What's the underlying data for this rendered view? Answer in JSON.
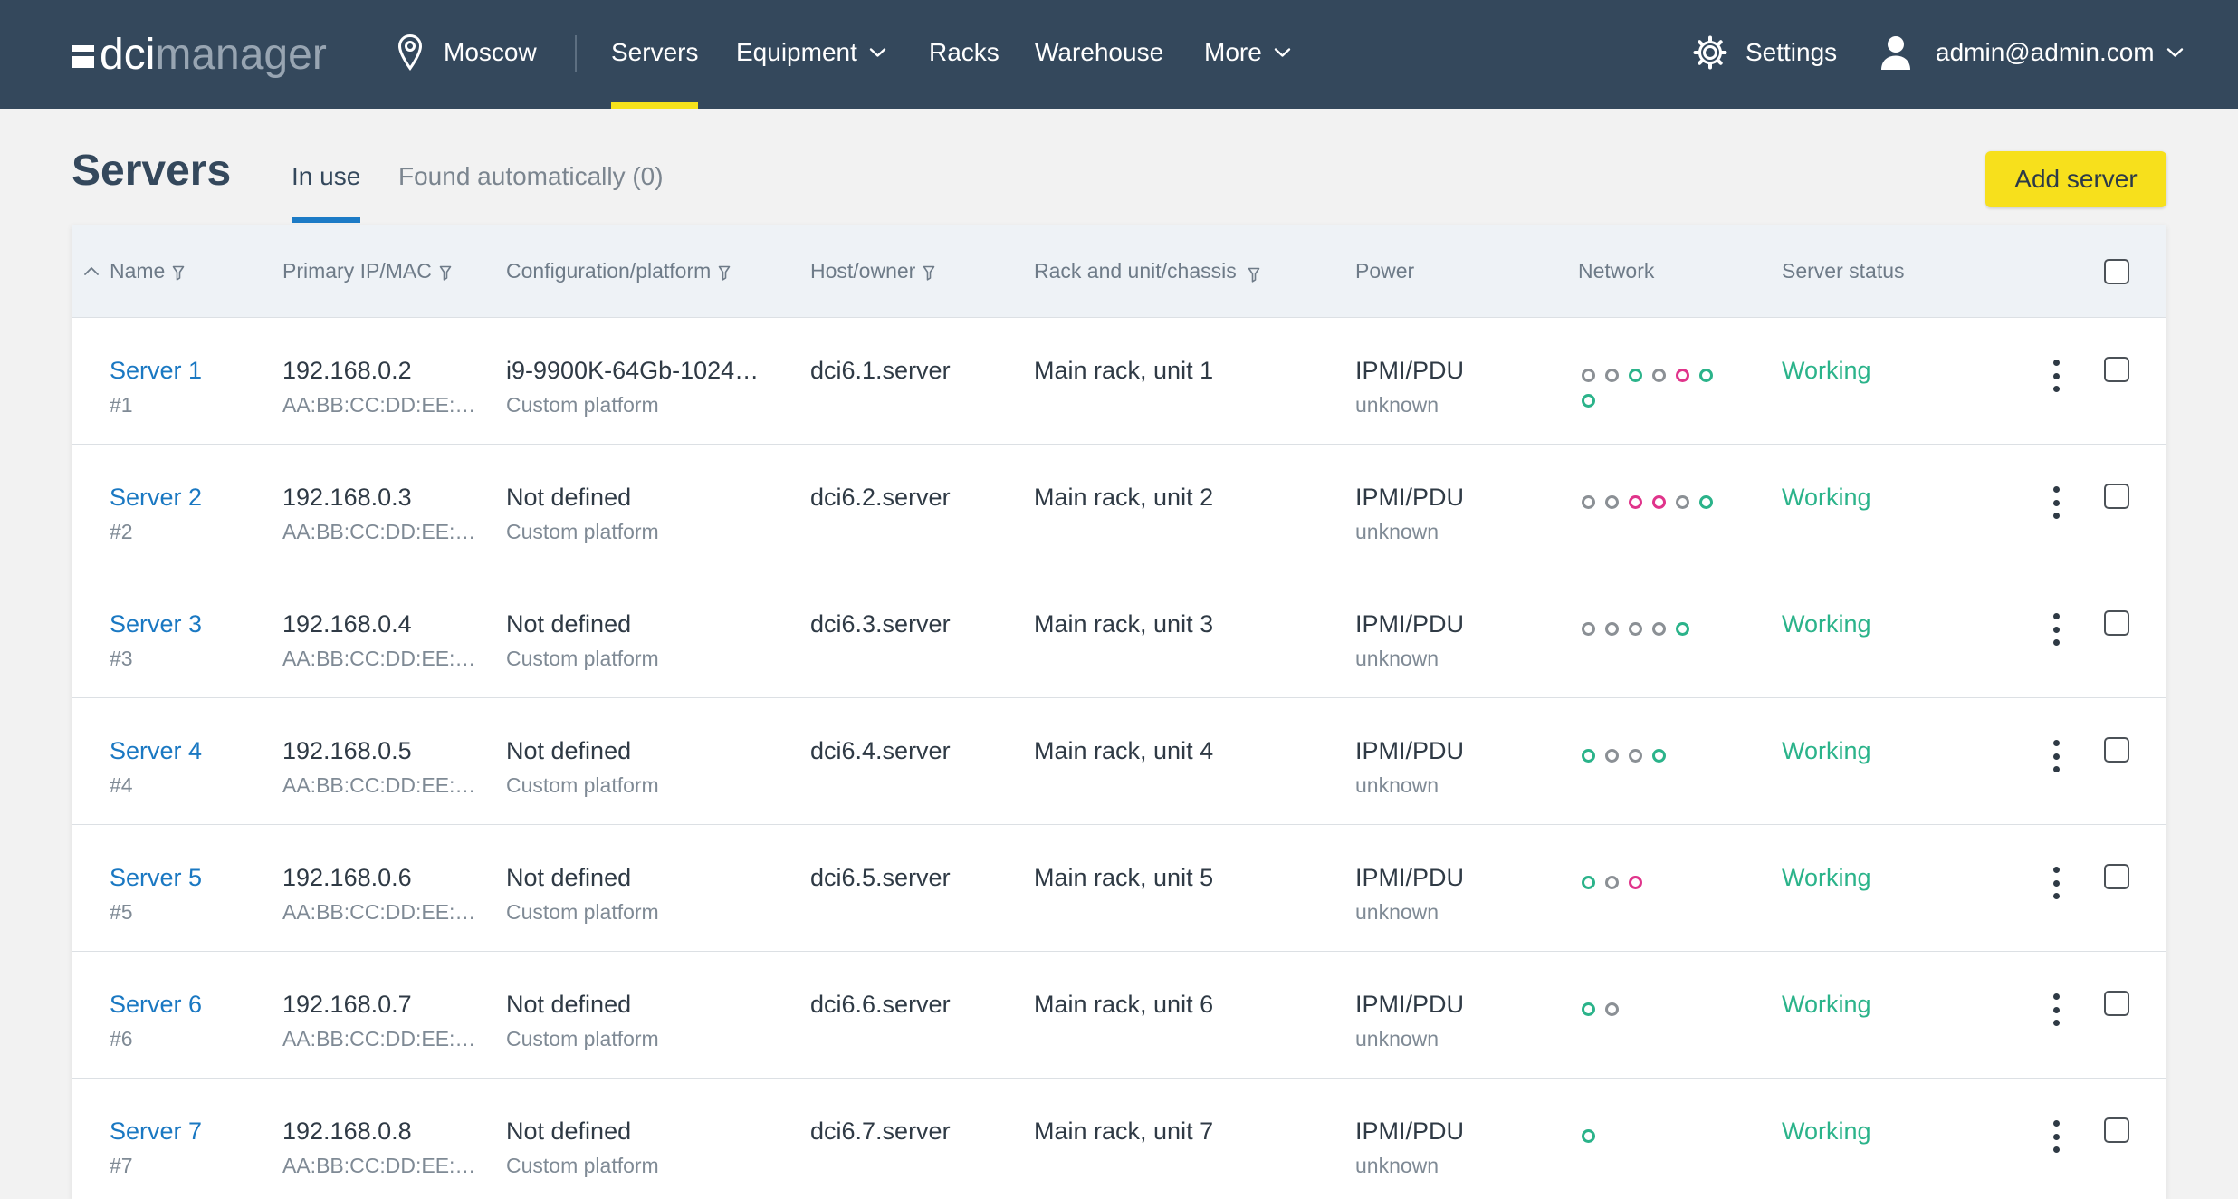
{
  "header": {
    "logo_prefix": "dci",
    "logo_suffix": "manager",
    "location": "Moscow",
    "nav": [
      {
        "label": "Servers",
        "active": true,
        "dropdown": false
      },
      {
        "label": "Equipment",
        "active": false,
        "dropdown": true
      },
      {
        "label": "Racks",
        "active": false,
        "dropdown": false
      },
      {
        "label": "Warehouse",
        "active": false,
        "dropdown": false
      },
      {
        "label": "More",
        "active": false,
        "dropdown": true
      }
    ],
    "settings_label": "Settings",
    "user_email": "admin@admin.com"
  },
  "page": {
    "title": "Servers",
    "tabs": [
      {
        "label": "In use",
        "active": true
      },
      {
        "label": "Found automatically (0)",
        "active": false
      }
    ],
    "add_button_label": "Add server"
  },
  "table": {
    "columns": [
      {
        "label": "Name",
        "sort_icon": "chevron-up-icon",
        "filter": true
      },
      {
        "label": "Primary IP/MAC",
        "filter": true
      },
      {
        "label": "Configuration/platform",
        "filter": true
      },
      {
        "label": "Host/owner",
        "filter": true
      },
      {
        "label": "Rack and unit/chassis",
        "filter": true
      },
      {
        "label": "Power",
        "filter": false
      },
      {
        "label": "Network",
        "filter": false
      },
      {
        "label": "Server status",
        "filter": false
      }
    ],
    "select_all_checked": false,
    "rows": [
      {
        "name": "Server 1",
        "id": "#1",
        "ip": "192.168.0.2",
        "mac": "AA:BB:CC:DD:EE:…",
        "config": "i9-9900K-64Gb-1024…",
        "platform": "Custom platform",
        "host": "dci6.1.server",
        "rack": "Main rack, unit 1",
        "power": "IPMI/PDU",
        "power_state": "unknown",
        "network": [
          "gray",
          "gray",
          "green",
          "gray",
          "pink",
          "green",
          "green"
        ],
        "status": "Working",
        "checked": false
      },
      {
        "name": "Server 2",
        "id": "#2",
        "ip": "192.168.0.3",
        "mac": "AA:BB:CC:DD:EE:…",
        "config": "Not defined",
        "platform": "Custom platform",
        "host": "dci6.2.server",
        "rack": "Main rack, unit 2",
        "power": "IPMI/PDU",
        "power_state": "unknown",
        "network": [
          "gray",
          "gray",
          "pink",
          "pink",
          "gray",
          "green"
        ],
        "status": "Working",
        "checked": false
      },
      {
        "name": "Server 3",
        "id": "#3",
        "ip": "192.168.0.4",
        "mac": "AA:BB:CC:DD:EE:…",
        "config": "Not defined",
        "platform": "Custom platform",
        "host": "dci6.3.server",
        "rack": "Main rack, unit 3",
        "power": "IPMI/PDU",
        "power_state": "unknown",
        "network": [
          "gray",
          "gray",
          "gray",
          "gray",
          "green"
        ],
        "status": "Working",
        "checked": false
      },
      {
        "name": "Server 4",
        "id": "#4",
        "ip": "192.168.0.5",
        "mac": "AA:BB:CC:DD:EE:…",
        "config": "Not defined",
        "platform": "Custom platform",
        "host": "dci6.4.server",
        "rack": "Main rack, unit 4",
        "power": "IPMI/PDU",
        "power_state": "unknown",
        "network": [
          "green",
          "gray",
          "gray",
          "green"
        ],
        "status": "Working",
        "checked": false
      },
      {
        "name": "Server 5",
        "id": "#5",
        "ip": "192.168.0.6",
        "mac": "AA:BB:CC:DD:EE:…",
        "config": "Not defined",
        "platform": "Custom platform",
        "host": "dci6.5.server",
        "rack": "Main rack, unit 5",
        "power": "IPMI/PDU",
        "power_state": "unknown",
        "network": [
          "green",
          "gray",
          "pink"
        ],
        "status": "Working",
        "checked": false
      },
      {
        "name": "Server 6",
        "id": "#6",
        "ip": "192.168.0.7",
        "mac": "AA:BB:CC:DD:EE:…",
        "config": "Not defined",
        "platform": "Custom platform",
        "host": "dci6.6.server",
        "rack": "Main rack, unit 6",
        "power": "IPMI/PDU",
        "power_state": "unknown",
        "network": [
          "green",
          "gray"
        ],
        "status": "Working",
        "checked": false
      },
      {
        "name": "Server 7",
        "id": "#7",
        "ip": "192.168.0.8",
        "mac": "AA:BB:CC:DD:EE:…",
        "config": "Not defined",
        "platform": "Custom platform",
        "host": "dci6.7.server",
        "rack": "Main rack, unit 7",
        "power": "IPMI/PDU",
        "power_state": "unknown",
        "network": [
          "green"
        ],
        "status": "Working",
        "checked": false
      }
    ]
  },
  "colors": {
    "header_bg": "#34485c",
    "accent": "#f5e11b",
    "link": "#1a78c2",
    "status_working": "#2bb38a",
    "tab_underline": "#1c7bc6"
  },
  "network_status_colors": {
    "gray": "#8b9095",
    "green": "#2bb38a",
    "pink": "#e0348b"
  }
}
